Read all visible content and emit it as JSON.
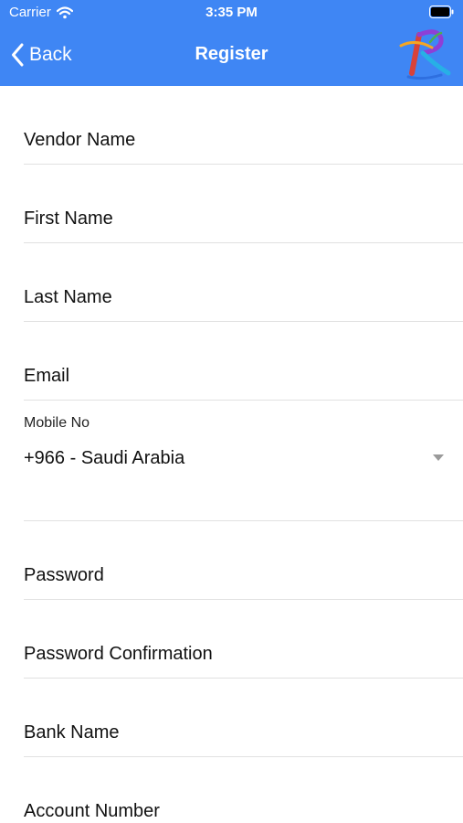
{
  "status_bar": {
    "carrier": "Carrier",
    "time": "3:35 PM"
  },
  "nav": {
    "back_label": "Back",
    "title": "Register"
  },
  "form": {
    "vendor_name": "Vendor Name",
    "first_name": "First Name",
    "last_name": "Last Name",
    "email": "Email",
    "mobile_caption": "Mobile No",
    "mobile_value": "+966 - Saudi Arabia",
    "password": "Password",
    "password_confirmation": "Password Confirmation",
    "bank_name": "Bank Name",
    "account_number": "Account Number"
  },
  "colors": {
    "header_bg": "#3f86f4",
    "divider": "#e1e1e1"
  },
  "icons": {
    "wifi": "wifi-icon",
    "battery": "battery-icon",
    "back": "back-chevron-icon",
    "logo": "app-logo",
    "dropdown": "dropdown-arrow-icon"
  }
}
